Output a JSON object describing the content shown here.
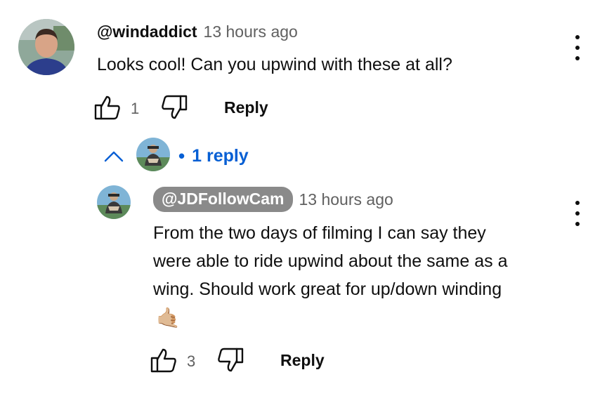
{
  "comment": {
    "handle": "@windaddict",
    "time": "13 hours ago",
    "text": "Looks cool! Can you upwind with these at all?",
    "like_count": "1",
    "reply_label": "Reply",
    "menu_icon": "more-vertical-icon"
  },
  "replies_toggle": {
    "label": "1 reply",
    "bullet": "•",
    "icon": "chevron-up-icon"
  },
  "reply": {
    "handle": "@JDFollowCam",
    "time": "13 hours ago",
    "text_lines": [
      "From the two days of filming I can say they",
      "were able to ride upwind about the same as a",
      "wing. Should work great for up/down winding"
    ],
    "emoji": "🤙🏼",
    "like_count": "3",
    "reply_label": "Reply",
    "menu_icon": "more-vertical-icon"
  },
  "colors": {
    "link_blue": "#065fd4",
    "secondary_text": "#606060",
    "chip_gray": "#8a8a8a"
  }
}
